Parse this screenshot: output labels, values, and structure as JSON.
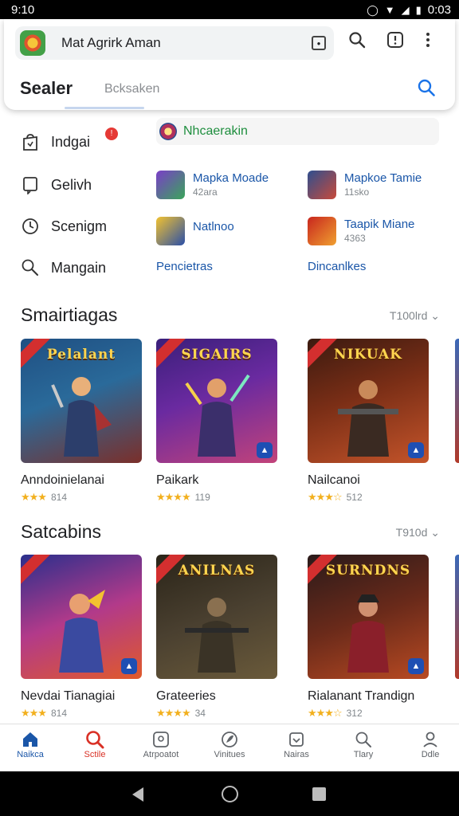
{
  "status_bar": {
    "time": "9:10",
    "clock_right": "0:03",
    "icons": [
      "location-icon",
      "wifi-icon",
      "signal-icon",
      "battery-icon"
    ]
  },
  "search": {
    "query": "Mat Agrirk Aman",
    "active_tab": "Sealer",
    "placeholder_tab": "Bcksaken"
  },
  "menu": [
    {
      "label": "Indgai",
      "icon": "bag-icon"
    },
    {
      "label": "Gelivh",
      "icon": "bookmark-icon"
    },
    {
      "label": "Scenigm",
      "icon": "clock-icon"
    },
    {
      "label": "Mangain",
      "icon": "search-icon"
    }
  ],
  "featured": {
    "label": "Nhcaerakin"
  },
  "quick_apps": [
    {
      "title": "Mapka Moade",
      "sub": "42ara"
    },
    {
      "title": "Mapkoe Tamie",
      "sub": "11sko"
    },
    {
      "title": "Natlnoo",
      "sub": ""
    },
    {
      "title": "Taapik Miane",
      "sub": "4363"
    }
  ],
  "links": {
    "left": "Pencietras",
    "right": "Dincanlkes"
  },
  "sections": [
    {
      "title": "Smairtiagas",
      "sort": "T100lrd",
      "cards": [
        {
          "title": "Anndoinielanai",
          "rating": "814",
          "banner": "Pelalant",
          "colors": [
            "#1f4f82",
            "#7b2f2a"
          ]
        },
        {
          "title": "Paikark",
          "rating": "119",
          "banner": "SIGAIRS",
          "colors": [
            "#3a1f7a",
            "#c2437a"
          ]
        },
        {
          "title": "Nailcanoi",
          "rating": "512",
          "banner": "NIKUAK",
          "colors": [
            "#3b1a10",
            "#c4542a"
          ]
        }
      ]
    },
    {
      "title": "Satcabins",
      "sort": "T910d",
      "cards": [
        {
          "title": "Nevdai Tianagiai",
          "rating": "814",
          "banner": "",
          "colors": [
            "#2a2f8c",
            "#e05a2a"
          ]
        },
        {
          "title": "Grateeries",
          "rating": "34",
          "banner": "ANILNAS",
          "colors": [
            "#2a2418",
            "#6a5a3a"
          ]
        },
        {
          "title": "Rialanant Trandign",
          "rating": "312",
          "banner": "SURNDNS",
          "colors": [
            "#2a1a1a",
            "#b84a22"
          ]
        }
      ]
    }
  ],
  "bottom_nav": [
    {
      "label": "Naikca",
      "icon": "home-icon"
    },
    {
      "label": "Sctile",
      "icon": "search-icon"
    },
    {
      "label": "Atrpoatot",
      "icon": "apps-icon"
    },
    {
      "label": "Vinitues",
      "icon": "leaf-icon"
    },
    {
      "label": "Nairas",
      "icon": "library-icon"
    },
    {
      "label": "Tlary",
      "icon": "search-icon"
    },
    {
      "label": "Ddle",
      "icon": "profile-icon"
    }
  ],
  "colors": {
    "accent": "#1a56a8",
    "star": "#f2b01e",
    "badge": "#e53935",
    "green": "#1e8e3e"
  }
}
